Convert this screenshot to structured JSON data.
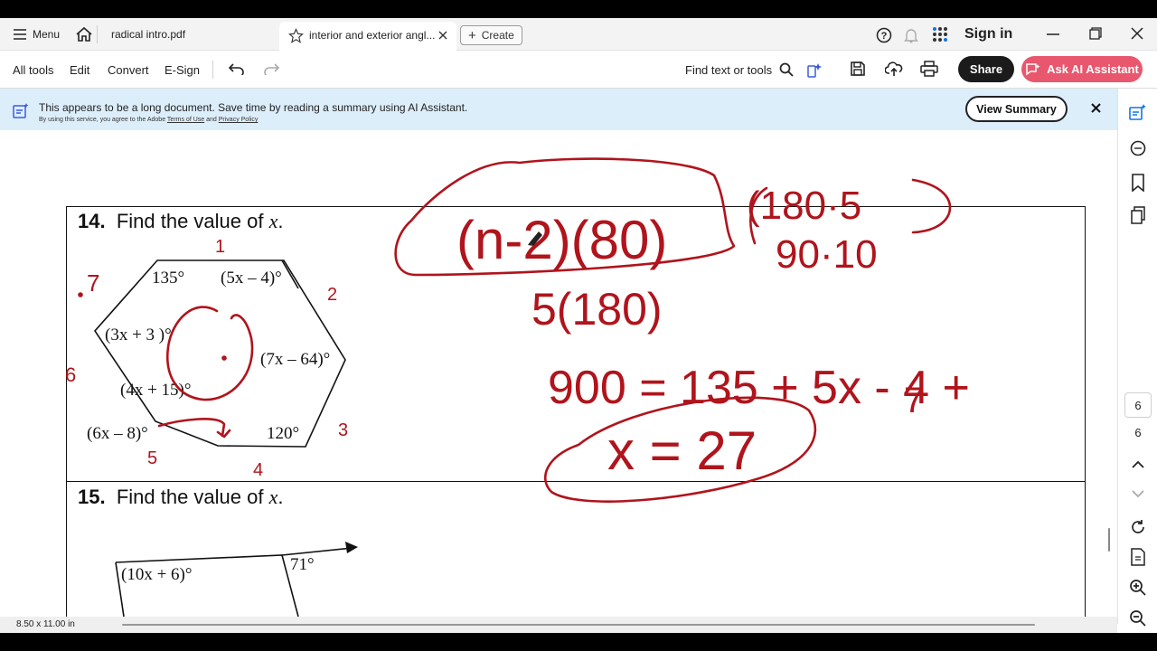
{
  "tabs": {
    "menu_label": "Menu",
    "tab1": "radical intro.pdf",
    "tab2": "interior and exterior angl...",
    "create_label": "Create",
    "sign_in": "Sign in"
  },
  "toolbar": {
    "all_tools": "All tools",
    "edit": "Edit",
    "convert": "Convert",
    "esign": "E-Sign",
    "find": "Find text or tools",
    "share": "Share",
    "ai_assistant": "Ask AI Assistant"
  },
  "banner": {
    "message": "This appears to be a long document. Save time by reading a summary using AI Assistant.",
    "legal_prefix": "By using this service, you agree to the Adobe",
    "terms": "Terms of Use",
    "and": "and",
    "privacy": "Privacy Policy",
    "view_summary": "View Summary"
  },
  "page_nav": {
    "current_page": "6",
    "total_pages": "6"
  },
  "status": {
    "page_size": "8.50 x 11.00 in"
  },
  "document": {
    "q14": {
      "number": "14.",
      "prompt": "Find the value of ",
      "var": "x",
      "period": "."
    },
    "q14_labels": {
      "a135": "135°",
      "a5x": "(5x – 4)°",
      "a3x": "(3x + 3",
      "a3x_end": ")°",
      "a7x": "(7x – 64)°",
      "a4x": "(4x + 15)°",
      "a6x": "(6x – 8)°",
      "a120": "120°"
    },
    "q15": {
      "number": "15.",
      "prompt": "Find the value of ",
      "var": "x",
      "period": "."
    },
    "q15_labels": {
      "a10x": "(10x + 6)°",
      "a71": "71°"
    }
  },
  "handwriting": {
    "formula": "(n-2)(80)",
    "calc1a": "(180·5",
    "calc1b": "90·10",
    "calc2": "5(180)",
    "equation": "900 = 135 + 5x - 4 +",
    "answer": "x = 27",
    "side1": "1",
    "side2": "2",
    "side3": "3",
    "side4": "4",
    "side5": "5",
    "side6": "6",
    "side7": "7",
    "side7b": "7"
  },
  "colors": {
    "ink": "#b0141c",
    "ai_button": "#e8576e",
    "banner_bg": "#ddeefb",
    "accent_blue": "#1473e6"
  }
}
